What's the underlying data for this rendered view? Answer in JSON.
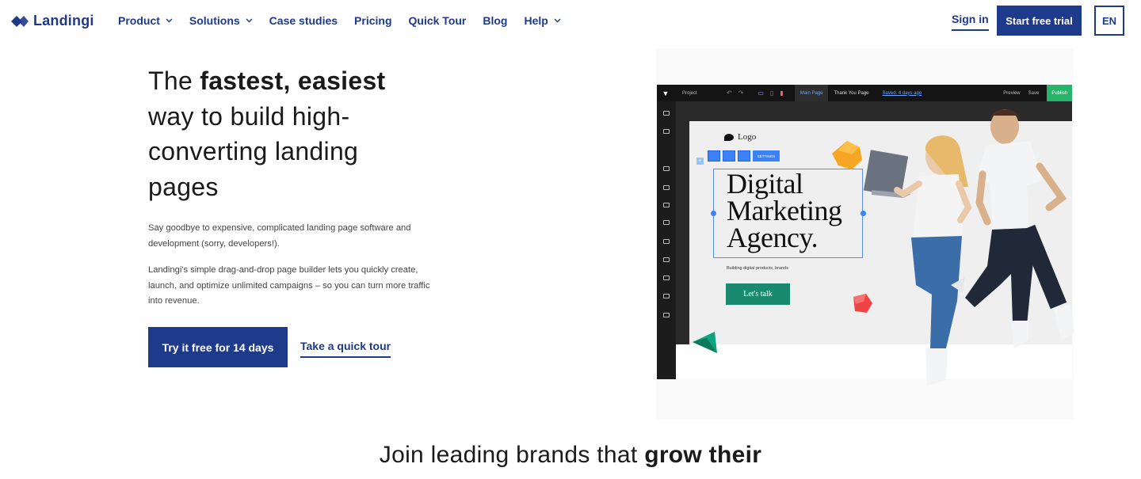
{
  "brand": {
    "name": "Landingi",
    "color": "#1f3a8a"
  },
  "nav": {
    "items": [
      {
        "label": "Product",
        "dropdown": true
      },
      {
        "label": "Solutions",
        "dropdown": true
      },
      {
        "label": "Case studies",
        "dropdown": false
      },
      {
        "label": "Pricing",
        "dropdown": false
      },
      {
        "label": "Quick Tour",
        "dropdown": false
      },
      {
        "label": "Blog",
        "dropdown": false
      },
      {
        "label": "Help",
        "dropdown": true
      }
    ],
    "sign_in": "Sign in",
    "start_trial": "Start free trial",
    "language": "EN"
  },
  "hero": {
    "headline_prefix": "The ",
    "headline_bold": "fastest, easiest",
    "headline_rest_1": "way to build high-",
    "headline_rest_2": "converting landing",
    "headline_rest_3": "pages",
    "para_1": "Say goodbye to expensive, complicated landing page software and development (sorry, developers!).",
    "para_2": "Landingi's simple drag-and-drop page builder lets you quickly create, launch, and optimize unlimited campaigns – so you can turn more traffic into revenue.",
    "cta_primary": "Try it free for 14 days",
    "cta_secondary": "Take a quick tour"
  },
  "editor": {
    "project": "Project",
    "tab_main": "Main Page",
    "tab_thanks": "Thank You Page",
    "saved": "Saved: 4 days ago",
    "preview": "Preview",
    "save": "Save",
    "publish": "Publish",
    "settings": "SETTINGS",
    "logo_text": "Logo",
    "title_line_1": "Digital",
    "title_line_2": "Marketing",
    "title_line_3": "Agency.",
    "subtitle": "Building digital products, brands",
    "button": "Let's talk"
  },
  "bottom": {
    "text_prefix": "Join leading brands that ",
    "text_bold": "grow their"
  }
}
